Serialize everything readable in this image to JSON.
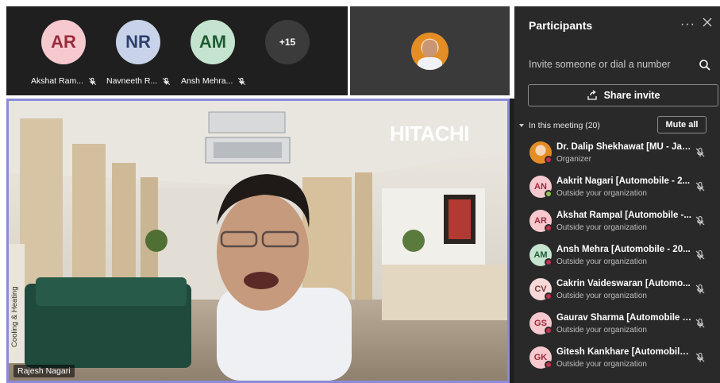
{
  "top_tiles": [
    {
      "initials": "AR",
      "name": "Akshat Ram...",
      "bg": "#f6c9cf",
      "fg": "#9a2b3b"
    },
    {
      "initials": "NR",
      "name": "Navneeth R...",
      "bg": "#c8d3ea",
      "fg": "#2d3f6b"
    },
    {
      "initials": "AM",
      "name": "Ansh Mehra...",
      "bg": "#c5e4cf",
      "fg": "#1d5c34"
    }
  ],
  "overflow_count": "+15",
  "main_video": {
    "speaker_name": "Rajesh Nagari",
    "brand_text": "HITACHI",
    "side_text": "Cooling & Heating"
  },
  "panel": {
    "title": "Participants",
    "more_label": "···",
    "invite_placeholder": "Invite someone or dial a number",
    "share_label": "Share invite",
    "section_label": "In this meeting (20)",
    "mute_all_label": "Mute all"
  },
  "participants": [
    {
      "initials": "",
      "name": "Dr. Dalip Shekhawat [MU - Jai...",
      "sub": "Organizer",
      "photo": true,
      "bg": "#e58d25",
      "fg": "#ffffff",
      "status": "#c4314b"
    },
    {
      "initials": "AN",
      "name": "Aakrit Nagari [Automobile - 2...",
      "sub": "Outside your organization",
      "photo": false,
      "bg": "#f6c9cf",
      "fg": "#9a2b3b",
      "status": "#92c353"
    },
    {
      "initials": "AR",
      "name": "Akshat Rampal [Automobile -...",
      "sub": "Outside your organization",
      "photo": false,
      "bg": "#f6c9cf",
      "fg": "#9a2b3b",
      "status": "#c4314b"
    },
    {
      "initials": "AM",
      "name": "Ansh Mehra [Automobile - 20...",
      "sub": "Outside your organization",
      "photo": false,
      "bg": "#c5e4cf",
      "fg": "#1d5c34",
      "status": "#c4314b"
    },
    {
      "initials": "CV",
      "name": "Cakrin Vaideswaran [Automo...",
      "sub": "Outside your organization",
      "photo": false,
      "bg": "#f6d8d8",
      "fg": "#7a3b3b",
      "status": "#c4314b"
    },
    {
      "initials": "GS",
      "name": "Gaurav Sharma [Automobile -...",
      "sub": "Outside your organization",
      "photo": false,
      "bg": "#f6c9cf",
      "fg": "#9a2b3b",
      "status": "#c4314b"
    },
    {
      "initials": "GK",
      "name": "Gitesh Kankhare [Automobile ...",
      "sub": "Outside your organization",
      "photo": false,
      "bg": "#f6c9cf",
      "fg": "#9a2b3b",
      "status": "#c4314b"
    }
  ]
}
